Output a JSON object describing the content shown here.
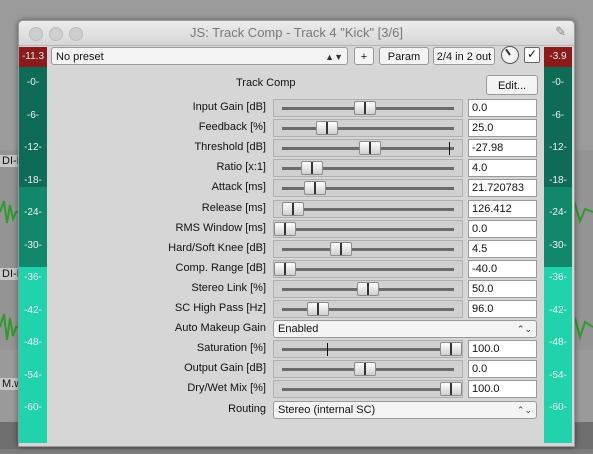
{
  "window": {
    "title": "JS: Track Comp - Track 4 \"Kick\" [3/6]",
    "pin_icon": "pin-icon"
  },
  "background": {
    "track_labels": [
      "DI-L",
      "DI-F",
      "M.w"
    ]
  },
  "toolbar": {
    "preset": "No preset",
    "plus_label": "+",
    "param_label": "Param",
    "io_label": "2/4 in 2 out",
    "enable_checked": true
  },
  "plugin": {
    "name": "Track Comp",
    "edit_label": "Edit..."
  },
  "meters": {
    "left_peak": "-11.3",
    "right_peak": "-3.9",
    "ticks": [
      "-0-",
      "-6-",
      "-12-",
      "-18-",
      "-24-",
      "-30-",
      "-36-",
      "-42-",
      "-48-",
      "-54-",
      "-60-"
    ]
  },
  "params": [
    {
      "label": "Input Gain [dB]",
      "value": "0.0",
      "pos": 0.48,
      "marker": null
    },
    {
      "label": "Feedback [%]",
      "value": "25.0",
      "pos": 0.25,
      "marker": null
    },
    {
      "label": "Threshold [dB]",
      "value": "-27.98",
      "pos": 0.51,
      "marker": 0.97
    },
    {
      "label": "Ratio [x:1]",
      "value": "4.0",
      "pos": 0.16,
      "marker": null
    },
    {
      "label": "Attack [ms]",
      "value": "21.720783",
      "pos": 0.18,
      "marker": 0.15
    },
    {
      "label": "Release [ms]",
      "value": "126.412",
      "pos": 0.05,
      "marker": null
    },
    {
      "label": "RMS Window [ms]",
      "value": "0.0",
      "pos": 0.0,
      "marker": null
    },
    {
      "label": "Hard/Soft Knee [dB]",
      "value": "4.5",
      "pos": 0.34,
      "marker": null
    },
    {
      "label": "Comp. Range [dB]",
      "value": "-40.0",
      "pos": 0.0,
      "marker": null
    },
    {
      "label": "Stereo Link [%]",
      "value": "50.0",
      "pos": 0.5,
      "marker": null
    },
    {
      "label": "SC High Pass [Hz]",
      "value": "96.0",
      "pos": 0.2,
      "marker": null
    },
    {
      "label": "Auto Makeup Gain",
      "value": "Enabled",
      "type": "select"
    },
    {
      "label": "Saturation [%]",
      "value": "100.0",
      "pos": 1.0,
      "marker": 0.26
    },
    {
      "label": "Output Gain [dB]",
      "value": "0.0",
      "pos": 0.48,
      "marker": null
    },
    {
      "label": "Dry/Wet Mix [%]",
      "value": "100.0",
      "pos": 1.0,
      "marker": null
    },
    {
      "label": "Routing",
      "value": "Stereo (internal SC)",
      "type": "select"
    }
  ]
}
